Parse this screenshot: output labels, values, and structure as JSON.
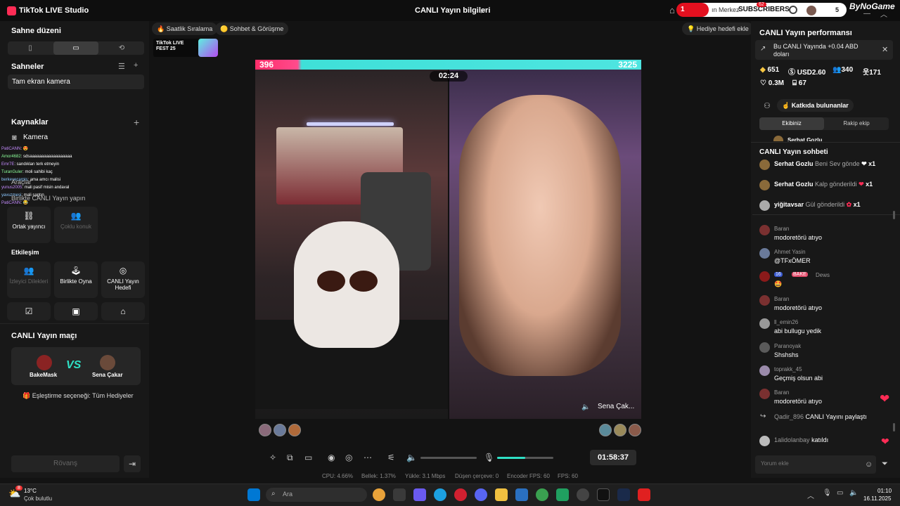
{
  "titlebar": {
    "app_title": "TikTok LIVE Studio",
    "live_info": "CANLI Yayın bilgileri",
    "overlay_count": "1",
    "overlay_merkez": "ın Merkez",
    "overlay_subscribers": "SUBSCRIBERS",
    "overlay_badge": "62",
    "overlay_5": "5",
    "brand": "ByNoGame"
  },
  "sidebar": {
    "scene_layout_title": "Sahne düzeni",
    "scenes_title": "Sahneler",
    "scene_item": "Tam ekran kamera",
    "sources_title": "Kaynaklar",
    "camera_label": "Kamera",
    "tools_title": "Araçlar",
    "collab_title": "Birlikte CANLI Yayın yapın",
    "collab": [
      {
        "label": "Ortak yayıncı",
        "enabled": true
      },
      {
        "label": "Çoklu konuk",
        "enabled": false
      }
    ],
    "interaction_title": "Etkileşim",
    "interaction": [
      {
        "label": "İzleyici Dilekleri",
        "enabled": false
      },
      {
        "label": "Birlikte Oyna",
        "enabled": true
      },
      {
        "label": "CANLI Yayın Hedefi",
        "enabled": true
      }
    ],
    "chat_overlay": [
      {
        "user": "PatiCANN",
        "text": ": 😍"
      },
      {
        "user": "Amor4682",
        "text": ": sdsaaaaaaaaaaaaaaaaaa"
      },
      {
        "user": "Emr7E",
        "text": ": sandıkları terk etmeyin"
      },
      {
        "user": "TuranGuler",
        "text": ": moli sahibi kaç"
      },
      {
        "user": "berkeyecarpis",
        "text": ": ama amcı malisi"
      },
      {
        "user": "yunus2005",
        "text": ": mali pasif misin andaval"
      },
      {
        "user": "yavuzmesi",
        "text": ": mali saptın"
      },
      {
        "user": "PatiCANN",
        "text": ": 😂"
      }
    ]
  },
  "match": {
    "title": "CANLI Yayın maçı",
    "player_left": "BakeMask",
    "player_right": "Sena Çakar",
    "vs_label": "VS",
    "pairing": "Eşleştirme seçeneği: Tüm Hediyeler",
    "rematch": "Rövanş"
  },
  "center": {
    "pill_hourly": "Saatlik Sıralama",
    "pill_chat": "Sohbet & Görüşme",
    "pill_goal": "Hediye hedefi ekle",
    "fest_text": "TikTok LIVE FEST 25",
    "score_left": "396",
    "score_right": "3225",
    "timer": "02:24",
    "right_name": "Sena Çak...",
    "elapsed": "01:58:37",
    "stats": {
      "cpu": "CPU:  4.66%",
      "memory": "Bellek:  1.37%",
      "upload": "Yükle:  3.1 Mbps",
      "dropped": "Düşen çerçeve:  0",
      "encoder_fps": "Encoder FPS:  60",
      "fps": "FPS:  60"
    },
    "mic_level": 0.5
  },
  "right_panel": {
    "perf_title": "CANLI Yayın performansı",
    "earnings": "Bu CANLI Yayında +0.04 ABD doları",
    "stats": {
      "diamonds": "651",
      "usd": "USD2.60",
      "viewers": "340",
      "likes_count": "171",
      "hearts": "0.3M",
      "gifts": "67"
    },
    "contributors": "Katkıda bulunanlar",
    "tab_your_team": "Ekibiniz",
    "tab_rival": "Rakip ekip",
    "contributor_partial": "Serhat Gozlu",
    "chat_title": "CANLI Yayın sohbeti",
    "gifts": [
      {
        "user": "Serhat Gozlu",
        "text": "Beni Sev gönde",
        "count": "x1"
      },
      {
        "user": "Serhat Gozlu",
        "text": "Kalp gönderildi",
        "count": "x1"
      },
      {
        "user": "yiğitavsar",
        "text": "Gül gönderildi",
        "count": "x1"
      }
    ],
    "messages": [
      {
        "user": "Baran",
        "text": "modoretörü atıyo"
      },
      {
        "user": "Ahmet Yasin",
        "text": "@TFxÖMER"
      },
      {
        "user": "Dews",
        "text": "🤩",
        "badge_level": "16",
        "badge_team": "BAKE"
      },
      {
        "user": "Baran",
        "text": "modoretörü atıyo"
      },
      {
        "user": "ll_emin26",
        "text": "abi bullugu yedik"
      },
      {
        "user": "Paranoyak",
        "text": "Shshshs"
      },
      {
        "user": "toprakk_45",
        "text": "Geçmiş olsun abi"
      },
      {
        "user": "Baran",
        "text": "modoretörü atıyo"
      }
    ],
    "system": [
      {
        "user": "Qadir_896",
        "text": "CANLI Yayını paylaştı"
      },
      {
        "user": "1alidolanbay",
        "text": "katıldı"
      }
    ],
    "input_placeholder": "Yorum ekle"
  },
  "taskbar": {
    "temp": "13°C",
    "weather": "Çok bulutlu",
    "search_placeholder": "Ara",
    "time": "01:10",
    "date": "16.11.2025",
    "weather_badge": "8"
  }
}
